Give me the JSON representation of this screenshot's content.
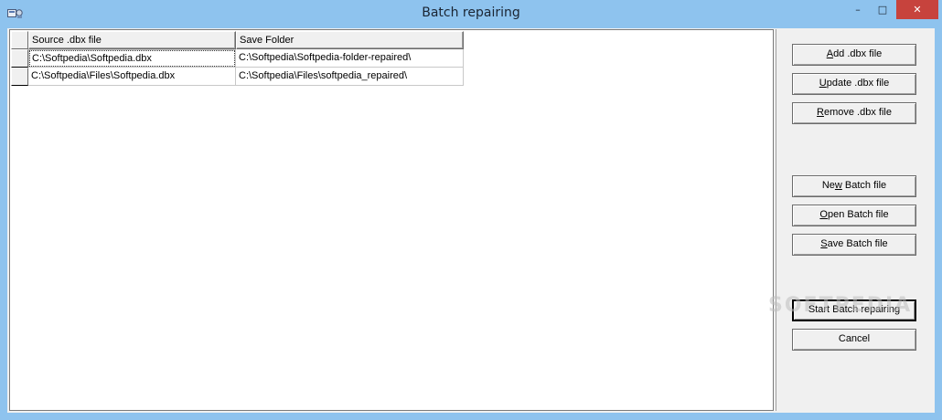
{
  "window": {
    "title": "Batch repairing",
    "minimize": "–",
    "maximize": "□",
    "close": "✕"
  },
  "grid": {
    "headers": [
      "Source .dbx file",
      "Save Folder"
    ],
    "rows": [
      [
        "C:\\Softpedia\\Softpedia.dbx",
        "C:\\Softpedia\\Softpedia-folder-repaired\\"
      ],
      [
        "C:\\Softpedia\\Files\\Softpedia.dbx",
        "C:\\Softpedia\\Files\\softpedia_repaired\\"
      ]
    ]
  },
  "buttons": {
    "add": {
      "mnemonic": "A",
      "rest": "dd .dbx file"
    },
    "update": {
      "mnemonic": "U",
      "rest": "pdate .dbx file"
    },
    "remove": {
      "mnemonic": "R",
      "rest": "emove .dbx file"
    },
    "new_batch": {
      "pre": "Ne",
      "mnemonic": "w",
      "rest": " Batch file"
    },
    "open_batch": {
      "mnemonic": "O",
      "rest": "pen Batch file"
    },
    "save_batch": {
      "mnemonic": "S",
      "rest": "ave Batch file"
    },
    "start": "Start Batch repairing",
    "cancel": "Cancel"
  },
  "watermark": "SOFTPEDIA"
}
